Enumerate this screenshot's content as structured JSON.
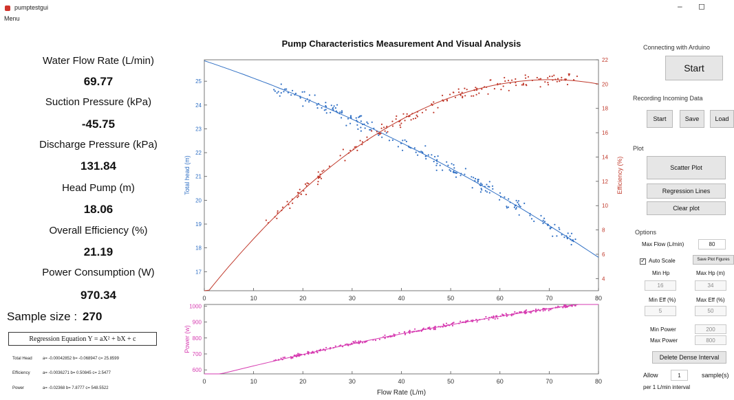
{
  "window": {
    "title": "pumptestgui",
    "menu": "Menu",
    "minimize_glyph": "–",
    "maximize_glyph": "◻"
  },
  "measurements": [
    {
      "label": "Water Flow Rate (L/min)",
      "value": "69.77"
    },
    {
      "label": "Suction Pressure (kPa)",
      "value": "-45.75"
    },
    {
      "label": "Discharge Pressure (kPa)",
      "value": "131.84"
    },
    {
      "label": "Head Pump (m)",
      "value": "18.06"
    },
    {
      "label": "Overall Efficiency (%)",
      "value": "21.19"
    },
    {
      "label": "Power Consumption (W)",
      "value": "970.34"
    }
  ],
  "sample": {
    "label": "Sample size :",
    "value": "270"
  },
  "regression": {
    "equation": "Regression Equation  Y = aX² + bX + c",
    "rows": [
      {
        "name": "Total Head",
        "text": "a= -0.00042852 b= -0.068947 c= 25.8599"
      },
      {
        "name": "Efficiency",
        "text": "a= -0.0036271 b= 0.50845 c= 2.5477"
      },
      {
        "name": "Power",
        "text": "a= -0.02368 b= 7.8777 c= 548.5522"
      }
    ]
  },
  "chart_data": [
    {
      "type": "scatter",
      "title": "Pump Characteristics Measurement And Visual Analysis",
      "xlabel": "",
      "xlim": [
        0,
        80
      ],
      "xticks": [
        "0",
        "10",
        "20",
        "30",
        "40",
        "50",
        "60",
        "70",
        "80"
      ],
      "ylim_left": [
        16.2,
        25.9
      ],
      "ylabel_left": "Total head (m)",
      "yticks_left": [
        "17",
        "18",
        "19",
        "20",
        "21",
        "22",
        "23",
        "24",
        "25"
      ],
      "ylim_right": [
        3,
        22
      ],
      "ylabel_right": "Efficiency (%)",
      "yticks_right": [
        "4",
        "6",
        "8",
        "10",
        "12",
        "14",
        "16",
        "18",
        "20",
        "22"
      ],
      "grid": false,
      "series": [
        {
          "axis": "left",
          "color": "#2f6fc4",
          "x_range": [
            14,
            76
          ],
          "coeffs": [
            -0.00042852,
            -0.068947,
            25.8599
          ],
          "spread": 0.35,
          "fit_range": [
            0,
            80
          ]
        },
        {
          "axis": "right",
          "color": "#c0392b",
          "x_range": [
            12,
            76
          ],
          "coeffs": [
            -0.0036271,
            0.50845,
            2.5477
          ],
          "spread": 0.6,
          "fit_range": [
            0,
            80
          ]
        }
      ]
    },
    {
      "type": "scatter",
      "title": "",
      "xlabel": "Flow Rate (L/m)",
      "xlim": [
        0,
        80
      ],
      "xticks": [
        "0",
        "10",
        "20",
        "30",
        "40",
        "50",
        "60",
        "70",
        "80"
      ],
      "ylim_left": [
        575,
        1010
      ],
      "ylabel_left": "Power (w)",
      "yticks_left": [
        "600",
        "700",
        "800",
        "900",
        "1000"
      ],
      "grid": false,
      "series": [
        {
          "axis": "left",
          "color": "#d63ab0",
          "x_range": [
            14,
            76
          ],
          "coeffs": [
            -0.02368,
            7.8777,
            548.5522
          ],
          "spread": 12,
          "fit_range": [
            0,
            80
          ]
        }
      ]
    }
  ],
  "controls": {
    "arduino": {
      "section": "Connecting with Arduino",
      "start": "Start"
    },
    "recording": {
      "section": "Recording Incoming Data",
      "start": "Start",
      "save": "Save",
      "load": "Load"
    },
    "plot": {
      "section": "Plot",
      "scatter": "Scatter Plot",
      "regression": "Regression Lines",
      "clear": "Clear plot"
    },
    "options": {
      "section": "Options",
      "max_flow_label": "Max Flow (L/min)",
      "max_flow": "80",
      "auto_scale_label": "Auto Scale",
      "save_figure": "Save Plot Figures",
      "min_hp_label": "Min Hp",
      "max_hp_label": "Max Hp (m)",
      "min_hp": "16",
      "max_hp": "34",
      "min_eff_label": "Min Eff (%)",
      "max_eff_label": "Max Eff (%)",
      "min_eff": "5",
      "max_eff": "50",
      "min_power_label": "Min Power",
      "min_power": "200",
      "max_power_label": "Max Power",
      "max_power": "800",
      "delete_dense": "Delete Dense Interval",
      "allow_label": "Allow",
      "allow_value": "1",
      "samples_label": "sample(s)",
      "per_label": "per 1 L/min interval"
    }
  }
}
